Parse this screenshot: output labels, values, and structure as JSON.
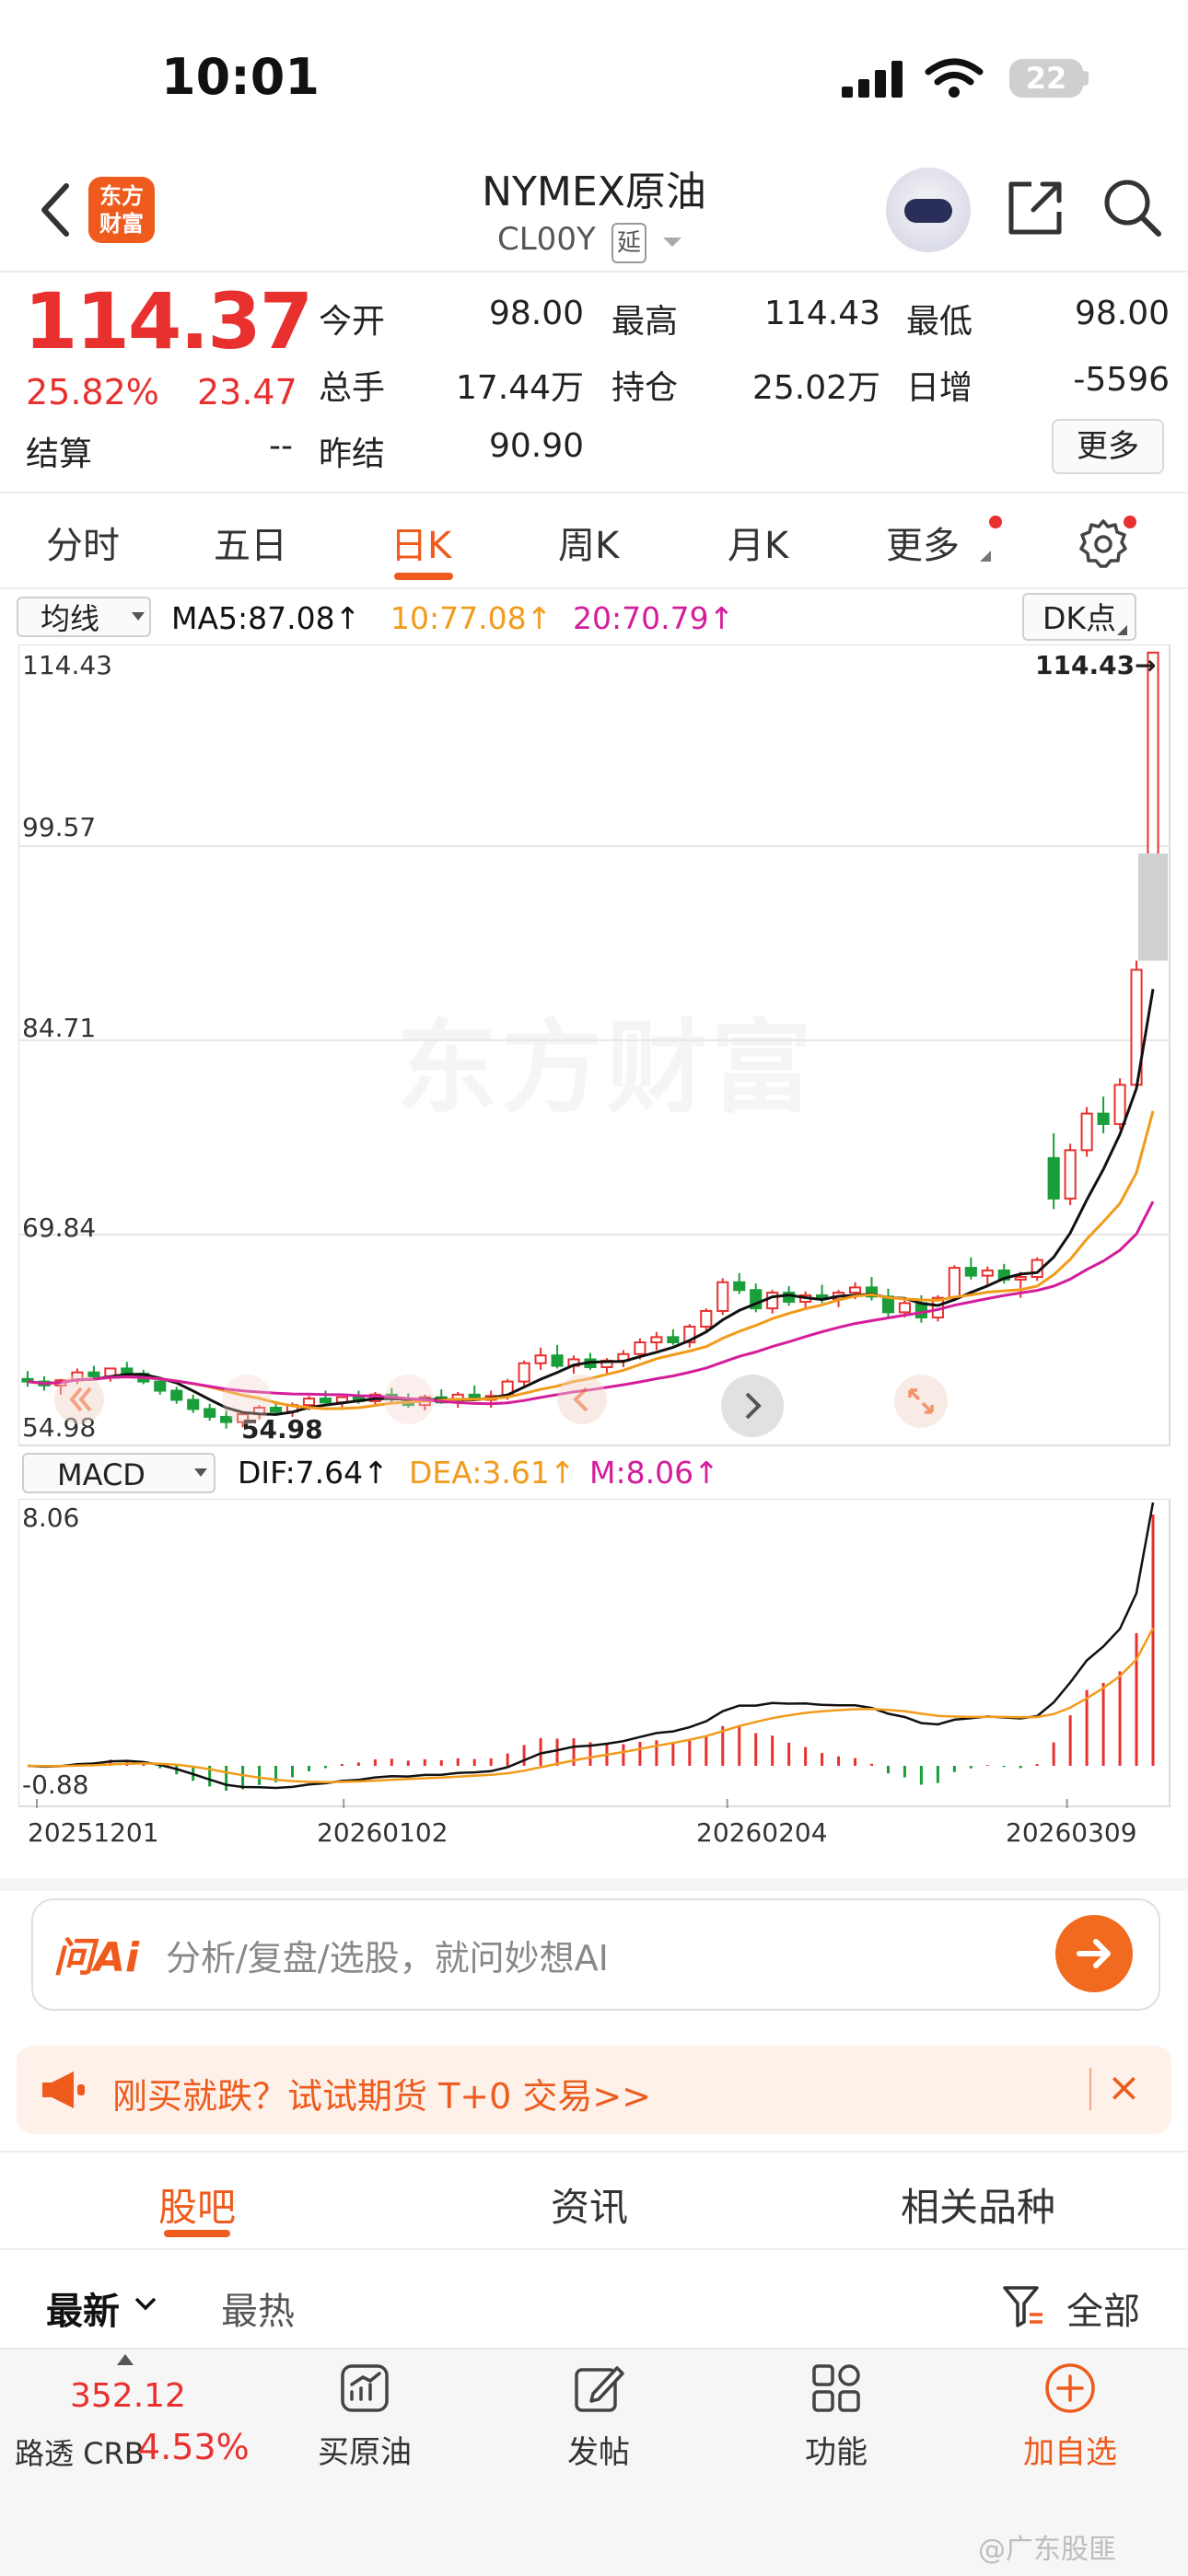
{
  "status": {
    "time": "10:01",
    "battery": "22"
  },
  "header": {
    "logo_line1": "东方",
    "logo_line2": "财富",
    "title": "NYMEX原油",
    "code": "CL00Y",
    "delay_badge": "延"
  },
  "quote": {
    "price": "114.37",
    "change_pct": "25.82%",
    "change": "23.47",
    "rows": [
      [
        {
          "label": "今开",
          "value": "98.00"
        },
        {
          "label": "最高",
          "value": "114.43"
        },
        {
          "label": "最低",
          "value": "98.00"
        }
      ],
      [
        {
          "label": "总手",
          "value": "17.44万"
        },
        {
          "label": "持仓",
          "value": "25.02万"
        },
        {
          "label": "日增",
          "value": "-5596"
        }
      ],
      [
        {
          "label": "结算",
          "value": "--"
        },
        {
          "label": "昨结",
          "value": "90.90"
        }
      ]
    ],
    "more": "更多"
  },
  "tabs": [
    "分时",
    "五日",
    "日K",
    "周K",
    "月K",
    "更多"
  ],
  "indicator": {
    "ma_select": "均线",
    "ma5": "MA5:87.08↑",
    "ma10": "10:77.08↑",
    "ma20": "20:70.79↑",
    "dk": "DK点",
    "macd_select": "MACD",
    "dif": "DIF:7.64↑",
    "dea": "DEA:3.61↑",
    "m": "M:8.06↑"
  },
  "chart_data": [
    {
      "type": "candlestick",
      "ylim": [
        54.98,
        114.43
      ],
      "yticks": [
        "114.43",
        "99.57",
        "84.71",
        "69.84",
        "54.98"
      ],
      "max_label": "114.43→",
      "min_label": "54.98",
      "watermark": "东方财富",
      "candles": [
        [
          58.8,
          59.4,
          58.2,
          58.6
        ],
        [
          58.6,
          59.0,
          57.9,
          58.3
        ],
        [
          58.3,
          58.8,
          57.6,
          58.7
        ],
        [
          58.7,
          59.6,
          58.4,
          59.3
        ],
        [
          59.3,
          59.8,
          58.8,
          59.0
        ],
        [
          59.0,
          59.5,
          58.6,
          59.6
        ],
        [
          59.6,
          60.1,
          59.0,
          59.2
        ],
        [
          59.2,
          59.5,
          58.4,
          58.6
        ],
        [
          58.6,
          58.9,
          57.6,
          57.9
        ],
        [
          57.9,
          58.2,
          56.9,
          57.2
        ],
        [
          57.2,
          57.6,
          56.2,
          56.5
        ],
        [
          56.5,
          56.9,
          55.6,
          55.9
        ],
        [
          55.9,
          56.4,
          55.0,
          55.5
        ],
        [
          55.5,
          56.3,
          55.1,
          56.1
        ],
        [
          56.1,
          56.8,
          55.7,
          56.6
        ],
        [
          56.6,
          57.1,
          56.0,
          56.3
        ],
        [
          56.3,
          57.0,
          55.9,
          56.8
        ],
        [
          56.8,
          57.5,
          56.4,
          57.3
        ],
        [
          57.3,
          57.9,
          56.8,
          57.0
        ],
        [
          57.0,
          57.4,
          56.5,
          57.4
        ],
        [
          57.4,
          57.9,
          56.9,
          57.1
        ],
        [
          57.1,
          57.8,
          56.7,
          57.6
        ],
        [
          57.6,
          58.1,
          57.0,
          57.3
        ],
        [
          57.3,
          57.7,
          56.6,
          56.8
        ],
        [
          56.8,
          57.6,
          56.4,
          57.4
        ],
        [
          57.4,
          58.0,
          56.9,
          57.0
        ],
        [
          57.0,
          57.8,
          56.6,
          57.6
        ],
        [
          57.6,
          58.3,
          57.1,
          57.2
        ],
        [
          57.2,
          57.9,
          56.6,
          57.5
        ],
        [
          57.5,
          58.8,
          57.2,
          58.6
        ],
        [
          58.6,
          60.2,
          58.3,
          60.0
        ],
        [
          60.0,
          61.2,
          59.5,
          60.6
        ],
        [
          60.6,
          61.4,
          59.6,
          59.8
        ],
        [
          59.8,
          60.6,
          59.2,
          60.3
        ],
        [
          60.3,
          60.8,
          59.5,
          59.7
        ],
        [
          59.7,
          60.4,
          59.1,
          60.2
        ],
        [
          60.2,
          61.0,
          59.7,
          60.7
        ],
        [
          60.7,
          61.9,
          60.3,
          61.6
        ],
        [
          61.6,
          62.4,
          61.0,
          62.0
        ],
        [
          62.0,
          62.6,
          61.4,
          61.6
        ],
        [
          61.6,
          63.0,
          61.2,
          62.8
        ],
        [
          62.8,
          64.2,
          62.5,
          64.0
        ],
        [
          64.0,
          66.5,
          63.7,
          66.2
        ],
        [
          66.2,
          66.9,
          65.3,
          65.6
        ],
        [
          65.6,
          66.1,
          63.9,
          64.2
        ],
        [
          64.2,
          65.6,
          63.8,
          65.4
        ],
        [
          65.4,
          65.9,
          64.4,
          64.7
        ],
        [
          64.7,
          65.5,
          64.1,
          65.2
        ],
        [
          65.2,
          66.0,
          64.6,
          64.9
        ],
        [
          64.9,
          65.6,
          64.3,
          65.4
        ],
        [
          65.4,
          66.2,
          64.9,
          65.8
        ],
        [
          65.8,
          66.6,
          64.8,
          65.1
        ],
        [
          65.1,
          65.7,
          63.5,
          63.9
        ],
        [
          63.9,
          64.9,
          63.5,
          64.6
        ],
        [
          64.6,
          65.2,
          63.1,
          63.5
        ],
        [
          63.5,
          65.2,
          63.2,
          65.0
        ],
        [
          65.0,
          67.5,
          64.8,
          67.3
        ],
        [
          67.3,
          68.1,
          66.4,
          66.7
        ],
        [
          66.7,
          67.4,
          66.0,
          67.1
        ],
        [
          67.1,
          67.6,
          66.1,
          66.4
        ],
        [
          66.4,
          67.0,
          65.0,
          66.6
        ],
        [
          66.6,
          68.1,
          66.3,
          67.9
        ],
        [
          75.7,
          77.6,
          71.8,
          72.6
        ],
        [
          72.6,
          76.8,
          72.1,
          76.3
        ],
        [
          76.3,
          79.6,
          75.8,
          79.1
        ],
        [
          79.1,
          80.4,
          77.6,
          78.3
        ],
        [
          78.3,
          81.8,
          77.9,
          81.3
        ],
        [
          81.3,
          90.8,
          80.9,
          90.1
        ],
        [
          98.0,
          114.43,
          98.0,
          114.37
        ]
      ],
      "ma5_label": "MA5",
      "ma10_label": "MA10",
      "ma20_label": "MA20"
    },
    {
      "type": "macd",
      "ylim": [
        -0.88,
        8.06
      ],
      "yticks": [
        "8.06",
        "-0.88"
      ],
      "x_labels": [
        "20251201",
        "20260102",
        "20260204",
        "20260309"
      ]
    }
  ],
  "ai": {
    "logo": "问Ai",
    "placeholder": "分析/复盘/选股，就问妙想AI"
  },
  "promo": {
    "text": "刚买就跌？试试期货 T+0 交易>>",
    "close": "×"
  },
  "sections": [
    "股吧",
    "资讯",
    "相关品种"
  ],
  "sort": {
    "latest": "最新",
    "hot": "最热",
    "filter": "全部"
  },
  "bottom": {
    "index_value": "352.12",
    "index_name": "路透 CRB",
    "index_pct": "4.53%",
    "items": [
      "买原油",
      "发帖",
      "功能",
      "加自选"
    ]
  },
  "footer_watermark": "@广东股匪",
  "colors": {
    "up": "#e8312f",
    "down": "#1a9e3a",
    "accent": "#ee5b1d",
    "ma5": "#111111",
    "ma10": "#f29b1a",
    "ma20": "#d41d9b"
  }
}
